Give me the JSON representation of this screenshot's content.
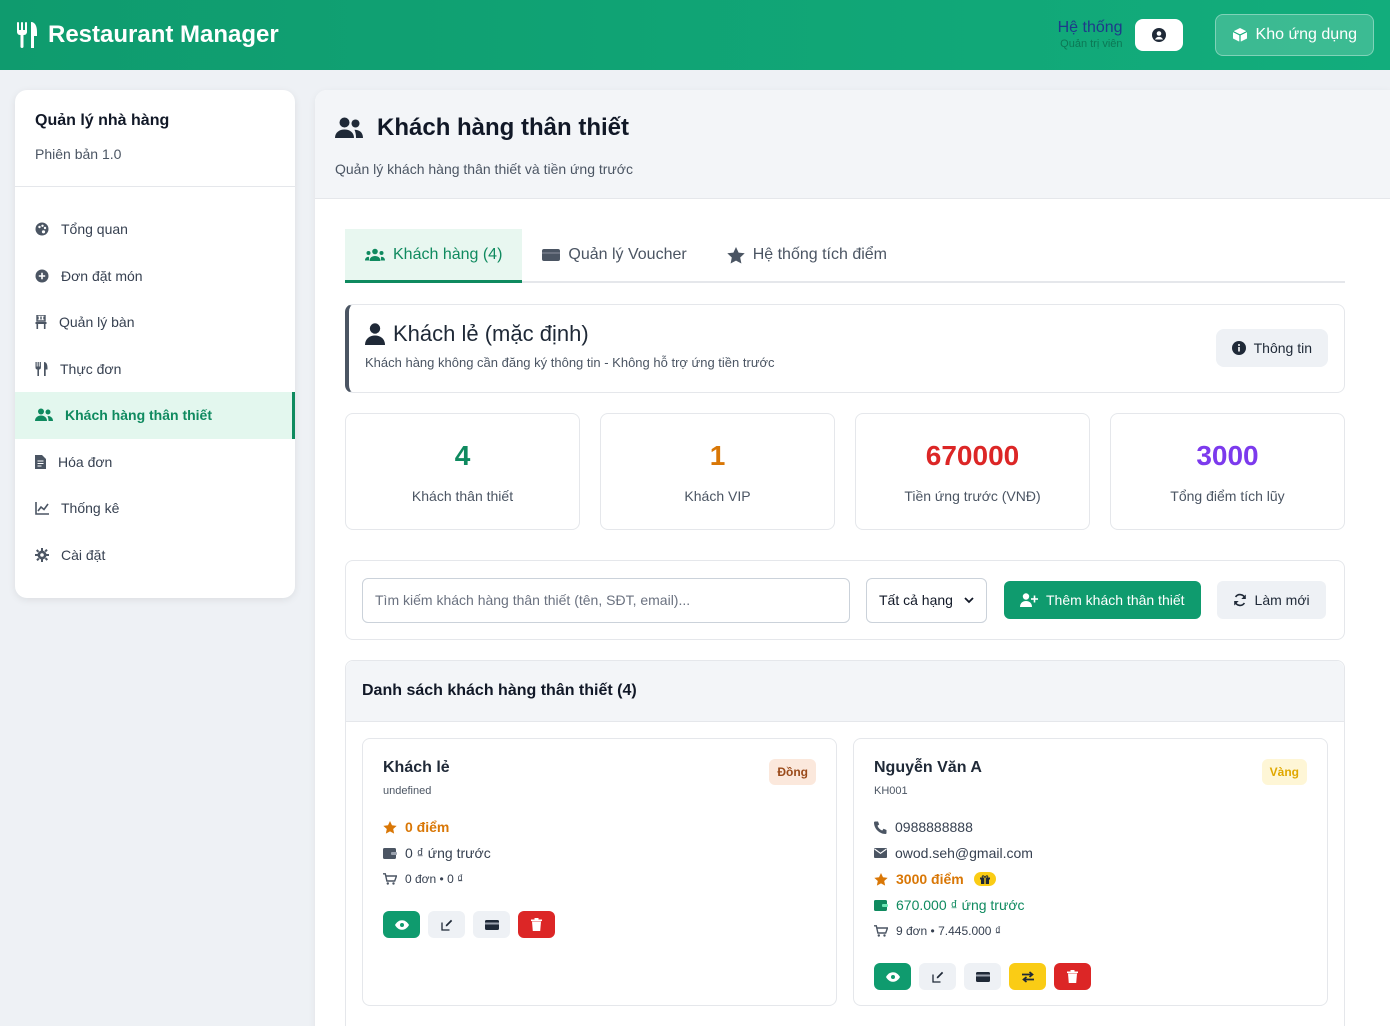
{
  "header": {
    "brand": "Restaurant Manager",
    "sys_title": "Hệ thống",
    "sys_sub": "Quản trị viên",
    "store_btn": "Kho ứng dụng"
  },
  "sidebar": {
    "title": "Quản lý nhà hàng",
    "version": "Phiên bản 1.0",
    "items": [
      {
        "label": "Tổng quan",
        "icon": "palette-icon"
      },
      {
        "label": "Đơn đặt món",
        "icon": "plus-circle-icon"
      },
      {
        "label": "Quản lý bàn",
        "icon": "chair-icon"
      },
      {
        "label": "Thực đơn",
        "icon": "utensils-icon"
      },
      {
        "label": "Khách hàng thân thiết",
        "icon": "users-icon",
        "active": true
      },
      {
        "label": "Hóa đơn",
        "icon": "file-icon"
      },
      {
        "label": "Thống kê",
        "icon": "chart-line-icon"
      },
      {
        "label": "Cài đặt",
        "icon": "gear-icon"
      }
    ]
  },
  "page": {
    "title": "Khách hàng thân thiết",
    "subtitle": "Quản lý khách hàng thân thiết và tiền ứng trước"
  },
  "tabs": [
    {
      "label": "Khách hàng (4)",
      "active": true
    },
    {
      "label": "Quản lý Voucher"
    },
    {
      "label": "Hệ thống tích điểm"
    }
  ],
  "guest": {
    "title": "Khách lẻ (mặc định)",
    "subtitle": "Khách hàng không cần đăng ký thông tin - Không hỗ trợ ứng tiền trước",
    "info_btn": "Thông tin"
  },
  "stats": [
    {
      "value": "4",
      "label": "Khách thân thiết",
      "color": "#0f8a5f"
    },
    {
      "value": "1",
      "label": "Khách VIP",
      "color": "#d97706"
    },
    {
      "value": "670000",
      "label": "Tiền ứng trước (VNĐ)",
      "color": "#dc2626"
    },
    {
      "value": "3000",
      "label": "Tổng điểm tích lũy",
      "color": "#7c3aed"
    }
  ],
  "toolbar": {
    "search_placeholder": "Tìm kiếm khách hàng thân thiết (tên, SĐT, email)...",
    "filter_value": "Tất cả hạng",
    "add_btn": "Thêm khách thân thiết",
    "refresh_btn": "Làm mới"
  },
  "list": {
    "title": "Danh sách khách hàng thân thiết (4)",
    "customers": [
      {
        "name": "Khách lẻ",
        "code": "undefined",
        "tier": "Đồng",
        "points": "0 điểm",
        "deposit": "0 ₫ ứng trước",
        "orders": "0 đơn • 0 ₫"
      },
      {
        "name": "Nguyễn Văn A",
        "code": "KH001",
        "tier": "Vàng",
        "phone": "0988888888",
        "email": "owod.seh@gmail.com",
        "points": "3000 điểm",
        "deposit": "670.000 ₫ ứng trước",
        "orders": "9 đơn • 7.445.000 ₫"
      }
    ]
  },
  "colors": {
    "primary": "#0f9b6e",
    "danger": "#dc2626",
    "warning": "#facc15",
    "points": "#d97706"
  }
}
